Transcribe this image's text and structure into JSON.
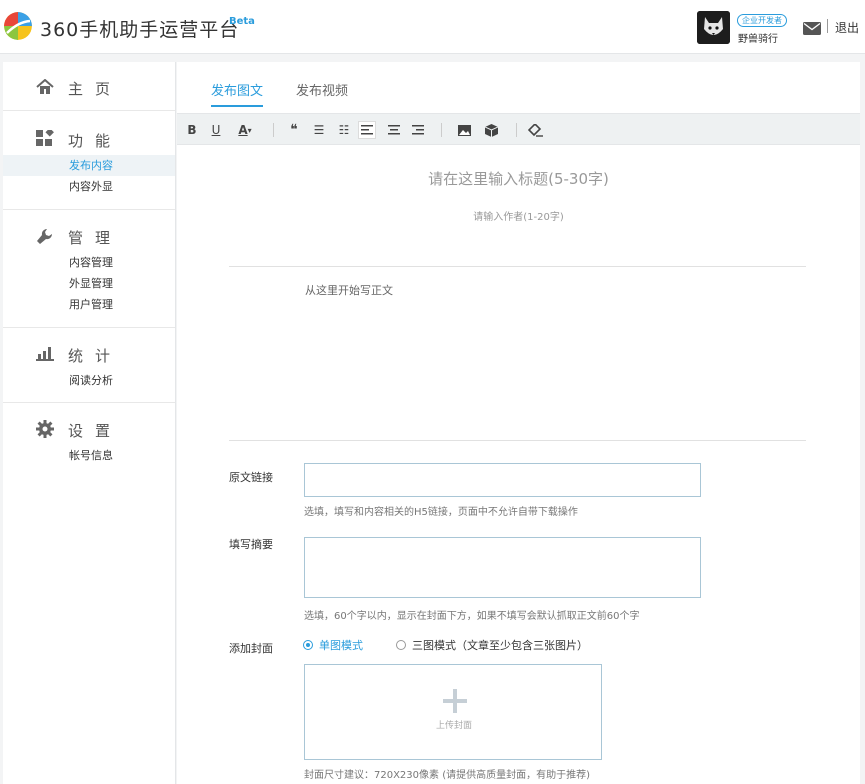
{
  "header": {
    "title": "360手机助手运营平台",
    "beta": "Beta",
    "developer_badge": "企业开发者",
    "username": "野兽骑行",
    "logout": "退出"
  },
  "sidebar": {
    "groups": [
      {
        "label": "主页",
        "icon": "home-icon",
        "items": []
      },
      {
        "label": "功能",
        "icon": "apps-icon",
        "items": [
          "发布内容",
          "内容外显"
        ],
        "active": "发布内容"
      },
      {
        "label": "管理",
        "icon": "wrench-icon",
        "items": [
          "内容管理",
          "外显管理",
          "用户管理"
        ]
      },
      {
        "label": "统计",
        "icon": "bar-chart-icon",
        "items": [
          "阅读分析"
        ]
      },
      {
        "label": "设置",
        "icon": "gear-icon",
        "items": [
          "帐号信息"
        ]
      }
    ]
  },
  "tabs": {
    "items": [
      "发布图文",
      "发布视频"
    ],
    "active": "发布图文"
  },
  "toolbar": [
    "bold-icon",
    "underline-icon",
    "font-color-icon",
    "quote-icon",
    "bullet-list-icon",
    "numbered-list-icon",
    "align-left-icon",
    "align-center-icon",
    "align-right-icon",
    "image-icon",
    "package-icon",
    "eraser-icon"
  ],
  "editor": {
    "title_placeholder": "请在这里输入标题(5-30字)",
    "author_placeholder": "请输入作者(1-20字)",
    "body_placeholder": "从这里开始写正文"
  },
  "form": {
    "link_label": "原文链接",
    "link_hint": "选填，填写和内容相关的H5链接，页面中不允许自带下载操作",
    "summary_label": "填写摘要",
    "summary_hint": "选填，60个字以内，显示在封面下方，如果不填写会默认抓取正文前60个字",
    "cover_label": "添加封面",
    "cover_options": [
      "单图模式",
      "三图模式（文章至少包含三张图片）"
    ],
    "cover_selected": "单图模式",
    "upload_label": "上传封面",
    "cover_hint": "封面尺寸建议：720X230像素 (请提供高质量封面，有助于推荐)"
  },
  "colors": {
    "accent": "#2a9cdc",
    "active_bg": "#eef3f6",
    "toolbar_bg": "#eef1f2"
  }
}
